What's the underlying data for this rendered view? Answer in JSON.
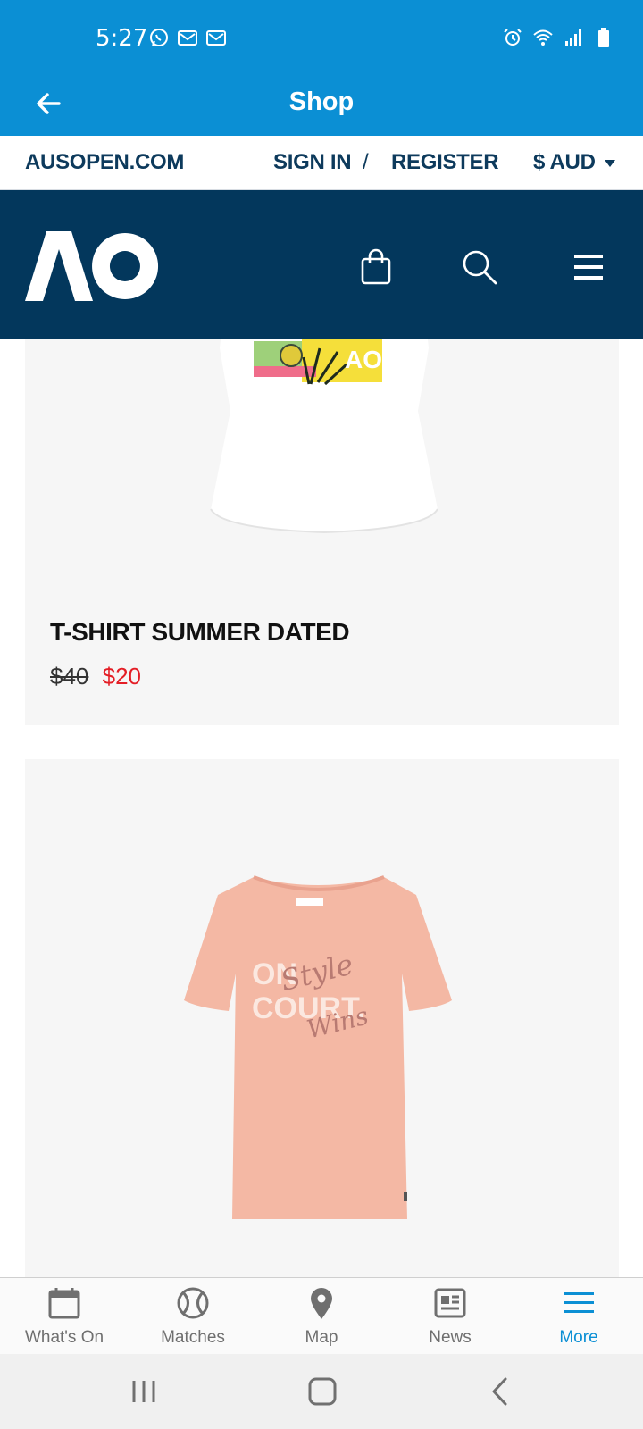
{
  "status_bar": {
    "time": "5:27",
    "left_icons": [
      "whatsapp-icon",
      "gmail-icon",
      "gmail-icon"
    ],
    "right_icons": [
      "alarm-icon",
      "wifi-icon",
      "signal-icon",
      "battery-icon"
    ]
  },
  "app_bar": {
    "title": "Shop",
    "back_icon": "back-arrow-icon"
  },
  "web_header": {
    "site_link": "AUSOPEN.COM",
    "sign_in": "SIGN IN",
    "separator": "/",
    "register": "REGISTER",
    "currency": "$ AUD"
  },
  "nav": {
    "logo_text": "AO",
    "icons": [
      "shopping-bag-icon",
      "search-icon",
      "menu-icon"
    ],
    "colors": {
      "navy": "#03375c",
      "brand_blue": "#0b8fd4"
    }
  },
  "products": [
    {
      "name": "T-SHIRT SUMMER DATED",
      "price_old": "$40",
      "price_new": "$20",
      "image": "white-tshirt-image"
    },
    {
      "name": "",
      "image": "pink-tshirt-image",
      "print_text": [
        "ON",
        "COURT.",
        "Style",
        "Wins"
      ]
    }
  ],
  "tabs": [
    {
      "label": "What's On",
      "icon": "calendar-icon",
      "active": false
    },
    {
      "label": "Matches",
      "icon": "tennis-ball-icon",
      "active": false
    },
    {
      "label": "Map",
      "icon": "map-pin-icon",
      "active": false
    },
    {
      "label": "News",
      "icon": "news-icon",
      "active": false
    },
    {
      "label": "More",
      "icon": "menu-icon",
      "active": true
    }
  ],
  "system_nav": [
    "recents-icon",
    "home-icon",
    "back-icon"
  ]
}
